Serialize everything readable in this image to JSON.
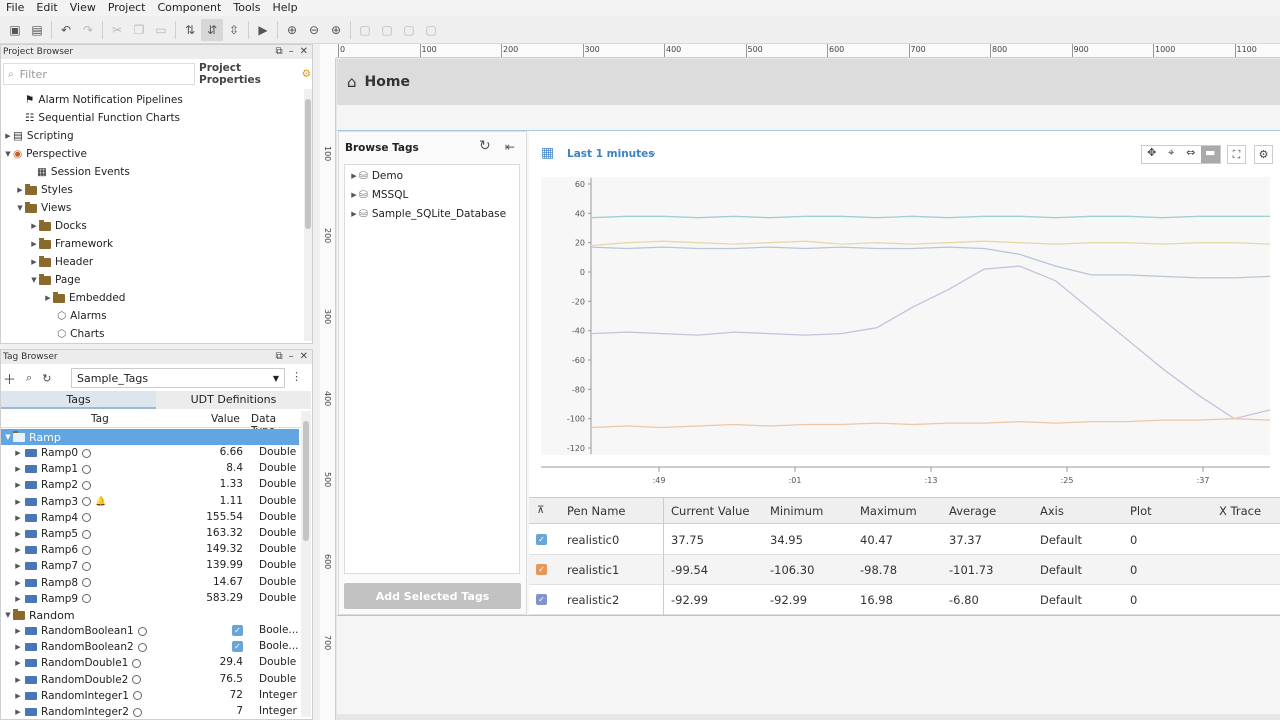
{
  "menu": [
    "File",
    "Edit",
    "View",
    "Project",
    "Component",
    "Tools",
    "Help"
  ],
  "project_browser": {
    "title": "Project Browser",
    "filter_placeholder": "Filter",
    "properties_label": "Project Properties",
    "items": [
      "Alarm Notification Pipelines",
      "Sequential Function Charts",
      "Scripting",
      "Perspective",
      "Session Events",
      "Styles",
      "Views",
      "Docks",
      "Framework",
      "Header",
      "Page",
      "Embedded",
      "Alarms",
      "Charts"
    ]
  },
  "tag_browser": {
    "title": "Tag Browser",
    "provider": "Sample_Tags",
    "tabs": [
      "Tags",
      "UDT Definitions"
    ],
    "columns": [
      "Tag",
      "Value",
      "Data Type"
    ],
    "ramp_folder": "Ramp",
    "random_folder": "Random",
    "rows": [
      {
        "name": "Ramp0",
        "value": "6.66",
        "type": "Double"
      },
      {
        "name": "Ramp1",
        "value": "8.4",
        "type": "Double"
      },
      {
        "name": "Ramp2",
        "value": "1.33",
        "type": "Double"
      },
      {
        "name": "Ramp3",
        "value": "1.11",
        "type": "Double"
      },
      {
        "name": "Ramp4",
        "value": "155.54",
        "type": "Double"
      },
      {
        "name": "Ramp5",
        "value": "163.32",
        "type": "Double"
      },
      {
        "name": "Ramp6",
        "value": "149.32",
        "type": "Double"
      },
      {
        "name": "Ramp7",
        "value": "139.99",
        "type": "Double"
      },
      {
        "name": "Ramp8",
        "value": "14.67",
        "type": "Double"
      },
      {
        "name": "Ramp9",
        "value": "583.29",
        "type": "Double"
      }
    ],
    "random_rows": [
      {
        "name": "RandomBoolean1",
        "value": "",
        "type": "Boole..."
      },
      {
        "name": "RandomBoolean2",
        "value": "",
        "type": "Boole..."
      },
      {
        "name": "RandomDouble1",
        "value": "29.4",
        "type": "Double"
      },
      {
        "name": "RandomDouble2",
        "value": "76.5",
        "type": "Double"
      },
      {
        "name": "RandomInteger1",
        "value": "72",
        "type": "Integer"
      },
      {
        "name": "RandomInteger2",
        "value": "7",
        "type": "Integer"
      }
    ]
  },
  "ruler_h": [
    "0",
    "100",
    "200",
    "300",
    "400",
    "500",
    "600",
    "700",
    "800",
    "900",
    "1000",
    "1100"
  ],
  "ruler_v": [
    "100",
    "200",
    "300",
    "400",
    "500",
    "600",
    "700"
  ],
  "view": {
    "title": "Home",
    "browse_title": "Browse Tags",
    "browse_items": [
      "Demo",
      "MSSQL",
      "Sample_SQLite_Database"
    ],
    "add_button": "Add Selected Tags",
    "range_label": "Last 1 minutes"
  },
  "chart_data": {
    "type": "line",
    "y_ticks": [
      "60",
      "40",
      "20",
      "0",
      "-20",
      "-40",
      "-60",
      "-80",
      "-100",
      "-120"
    ],
    "x_ticks": [
      ":49",
      ":01",
      ":13",
      ":25",
      ":37"
    ],
    "ylim": [
      -120,
      60
    ],
    "series": [
      {
        "color": "#9ed0d4",
        "values": [
          37,
          38,
          38,
          37,
          38,
          37,
          38,
          38,
          37,
          38,
          37,
          38,
          38,
          37,
          38,
          38,
          37,
          38,
          38,
          38
        ]
      },
      {
        "color": "#e8d8a8",
        "values": [
          18,
          20,
          21,
          20,
          19,
          20,
          21,
          19,
          20,
          19,
          20,
          21,
          20,
          19,
          20,
          20,
          19,
          20,
          20,
          19
        ]
      },
      {
        "color": "#b7c6d6",
        "values": [
          17,
          16,
          17,
          16,
          16,
          17,
          16,
          17,
          16,
          16,
          17,
          16,
          12,
          4,
          -2,
          -2,
          -3,
          -4,
          -4,
          -3
        ]
      },
      {
        "color": "#c8c0dd",
        "values": [
          -42,
          -41,
          -42,
          -43,
          -41,
          -42,
          -43,
          -42,
          -38,
          -24,
          -12,
          2,
          4,
          -6,
          -26,
          -46,
          -66,
          -84,
          -100,
          -94
        ]
      },
      {
        "color": "#eec7a5",
        "values": [
          -106,
          -105,
          -106,
          -105,
          -104,
          -105,
          -104,
          -104,
          -103,
          -104,
          -103,
          -103,
          -102,
          -103,
          -102,
          -102,
          -101,
          -101,
          -100,
          -101
        ]
      }
    ]
  },
  "pens": {
    "columns": [
      "Pen Name",
      "Current Value",
      "Minimum",
      "Maximum",
      "Average",
      "Axis",
      "Plot",
      "X Trace"
    ],
    "rows": [
      {
        "name": "realistic0",
        "current": "37.75",
        "min": "34.95",
        "max": "40.47",
        "avg": "37.37",
        "axis": "Default",
        "plot": "0",
        "color": "#6aa5d6"
      },
      {
        "name": "realistic1",
        "current": "-99.54",
        "min": "-106.30",
        "max": "-98.78",
        "avg": "-101.73",
        "axis": "Default",
        "plot": "0",
        "color": "#e8955a"
      },
      {
        "name": "realistic2",
        "current": "-92.99",
        "min": "-92.99",
        "max": "16.98",
        "avg": "-6.80",
        "axis": "Default",
        "plot": "0",
        "color": "#7f95c8"
      }
    ]
  }
}
